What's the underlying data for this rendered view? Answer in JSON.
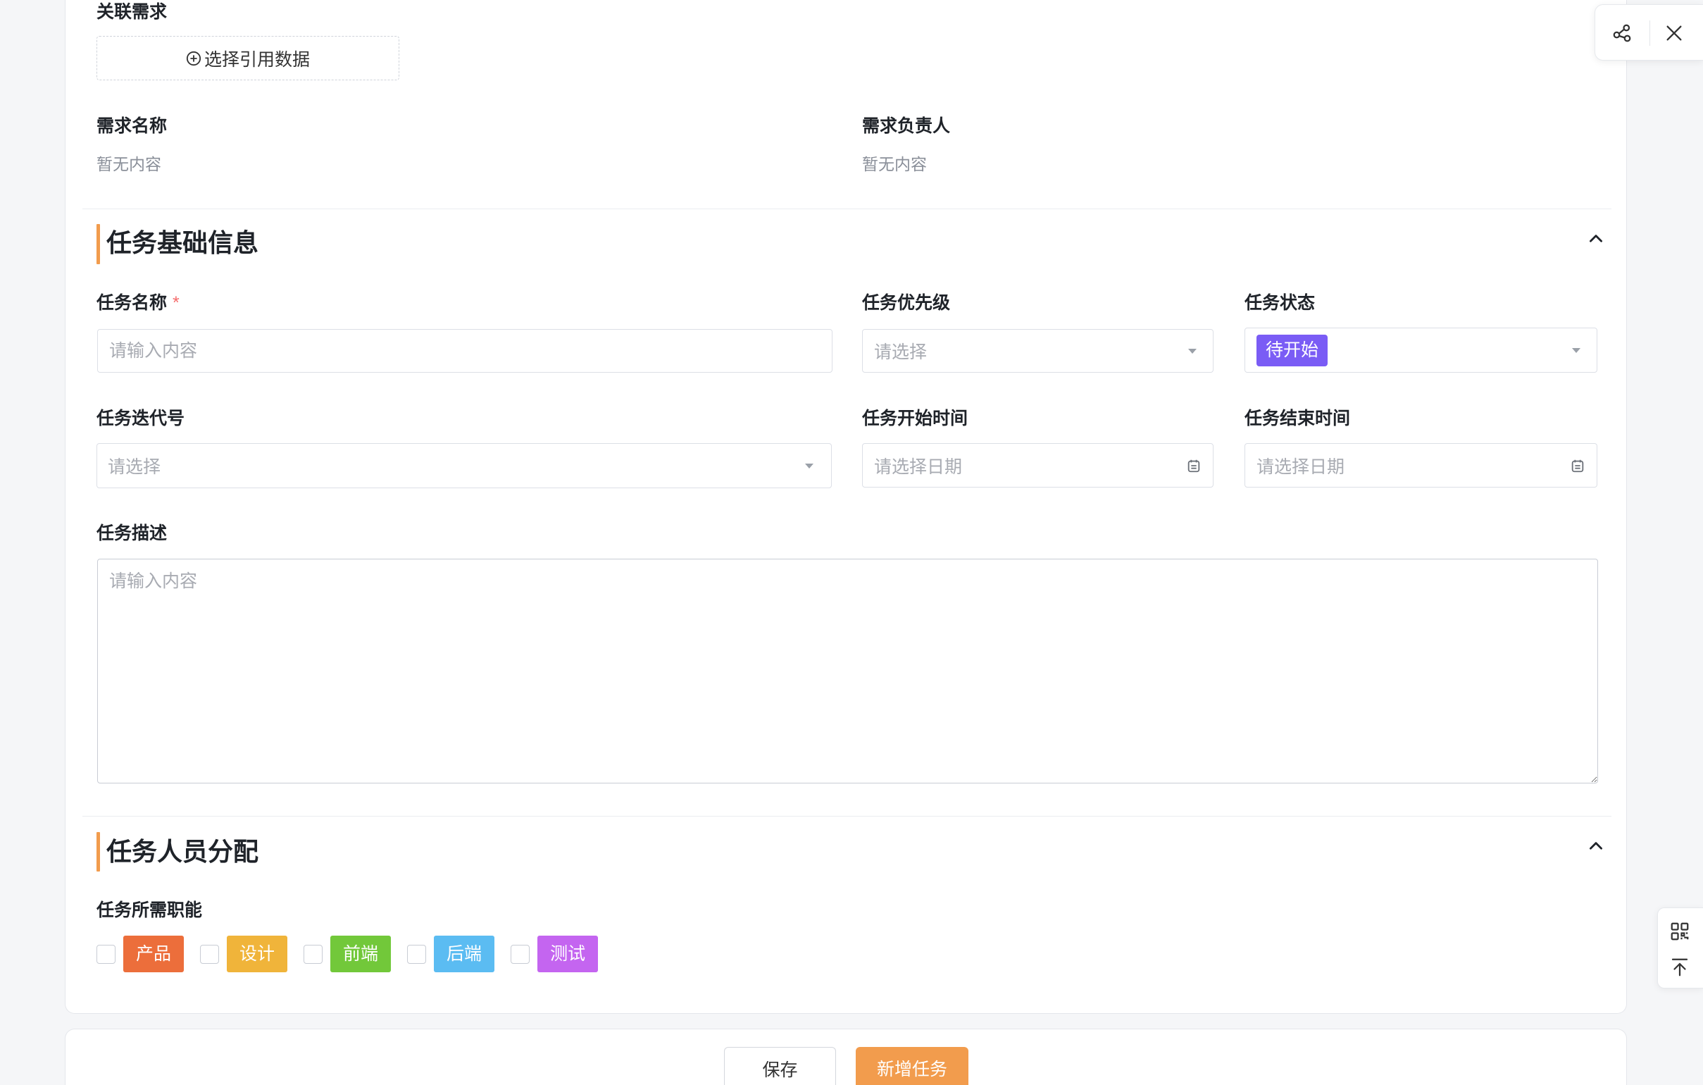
{
  "related": {
    "label": "关联需求",
    "select_button": "选择引用数据",
    "fields": [
      {
        "label": "需求名称",
        "value": "暂无内容"
      },
      {
        "label": "需求负责人",
        "value": "暂无内容"
      }
    ]
  },
  "basic_section": {
    "title": "任务基础信息",
    "task_name": {
      "label": "任务名称",
      "required_mark": "*",
      "placeholder": "请输入内容"
    },
    "priority": {
      "label": "任务优先级",
      "placeholder": "请选择"
    },
    "status": {
      "label": "任务状态",
      "value": "待开始",
      "color": "#7a5cf5"
    },
    "iteration": {
      "label": "任务迭代号",
      "placeholder": "请选择"
    },
    "start_time": {
      "label": "任务开始时间",
      "placeholder": "请选择日期"
    },
    "end_time": {
      "label": "任务结束时间",
      "placeholder": "请选择日期"
    },
    "description": {
      "label": "任务描述",
      "placeholder": "请输入内容"
    }
  },
  "staff_section": {
    "title": "任务人员分配",
    "roles_label": "任务所需职能",
    "roles": [
      {
        "label": "产品",
        "color": "#ec6e3b",
        "checked": false
      },
      {
        "label": "设计",
        "color": "#f0b43a",
        "checked": false
      },
      {
        "label": "前端",
        "color": "#72c83a",
        "checked": false
      },
      {
        "label": "后端",
        "color": "#5bbcf2",
        "checked": false
      },
      {
        "label": "测试",
        "color": "#c465f0",
        "checked": false
      }
    ]
  },
  "footer": {
    "save_label": "保存",
    "add_task_label": "新增任务"
  },
  "toolbar": {
    "icons": [
      "share-icon",
      "close-icon"
    ]
  },
  "side_tools": {
    "icons": [
      "qrcode-icon",
      "back-to-top-icon"
    ]
  },
  "theme": {
    "accent": "#f29c4d",
    "required": "#f56c6c",
    "page_background": "#f5f6f8"
  }
}
